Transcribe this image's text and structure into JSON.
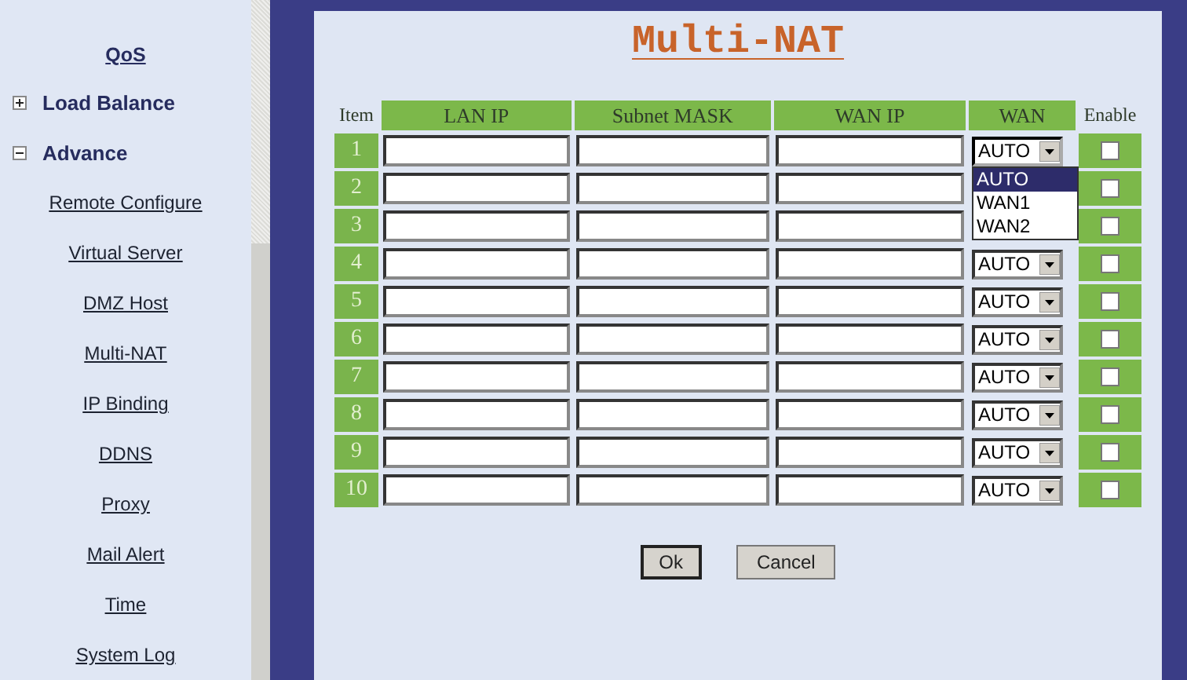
{
  "sidebar": {
    "items": [
      {
        "label": "QoS",
        "kind": "heading"
      },
      {
        "label": "Load Balance",
        "kind": "group",
        "expanded": false
      },
      {
        "label": "Advance",
        "kind": "group",
        "expanded": true
      },
      {
        "label": "Remote Configure",
        "kind": "link"
      },
      {
        "label": "Virtual Server",
        "kind": "link"
      },
      {
        "label": "DMZ Host",
        "kind": "link"
      },
      {
        "label": "Multi-NAT",
        "kind": "link"
      },
      {
        "label": "IP Binding",
        "kind": "link"
      },
      {
        "label": "DDNS",
        "kind": "link"
      },
      {
        "label": "Proxy",
        "kind": "link"
      },
      {
        "label": "Mail Alert",
        "kind": "link"
      },
      {
        "label": "Time",
        "kind": "link"
      },
      {
        "label": "System Log",
        "kind": "link"
      }
    ]
  },
  "title": "Multi-NAT",
  "table": {
    "columns": [
      "Item",
      "LAN IP",
      "Subnet MASK",
      "WAN IP",
      "WAN",
      "Enable"
    ],
    "rows": [
      {
        "item": "1",
        "wan": "AUTO",
        "enable": false,
        "open": true
      },
      {
        "item": "2",
        "enable": false
      },
      {
        "item": "3",
        "enable": false
      },
      {
        "item": "4",
        "wan": "AUTO",
        "enable": false
      },
      {
        "item": "5",
        "wan": "AUTO",
        "enable": false
      },
      {
        "item": "6",
        "wan": "AUTO",
        "enable": false
      },
      {
        "item": "7",
        "wan": "AUTO",
        "enable": false
      },
      {
        "item": "8",
        "wan": "AUTO",
        "enable": false
      },
      {
        "item": "9",
        "wan": "AUTO",
        "enable": false
      },
      {
        "item": "10",
        "wan": "AUTO",
        "enable": false
      }
    ]
  },
  "dropdown": {
    "options": [
      {
        "label": "AUTO",
        "selected": true
      },
      {
        "label": "WAN1",
        "selected": false
      },
      {
        "label": "WAN2",
        "selected": false
      }
    ]
  },
  "buttons": [
    "Ok",
    "Cancel"
  ]
}
